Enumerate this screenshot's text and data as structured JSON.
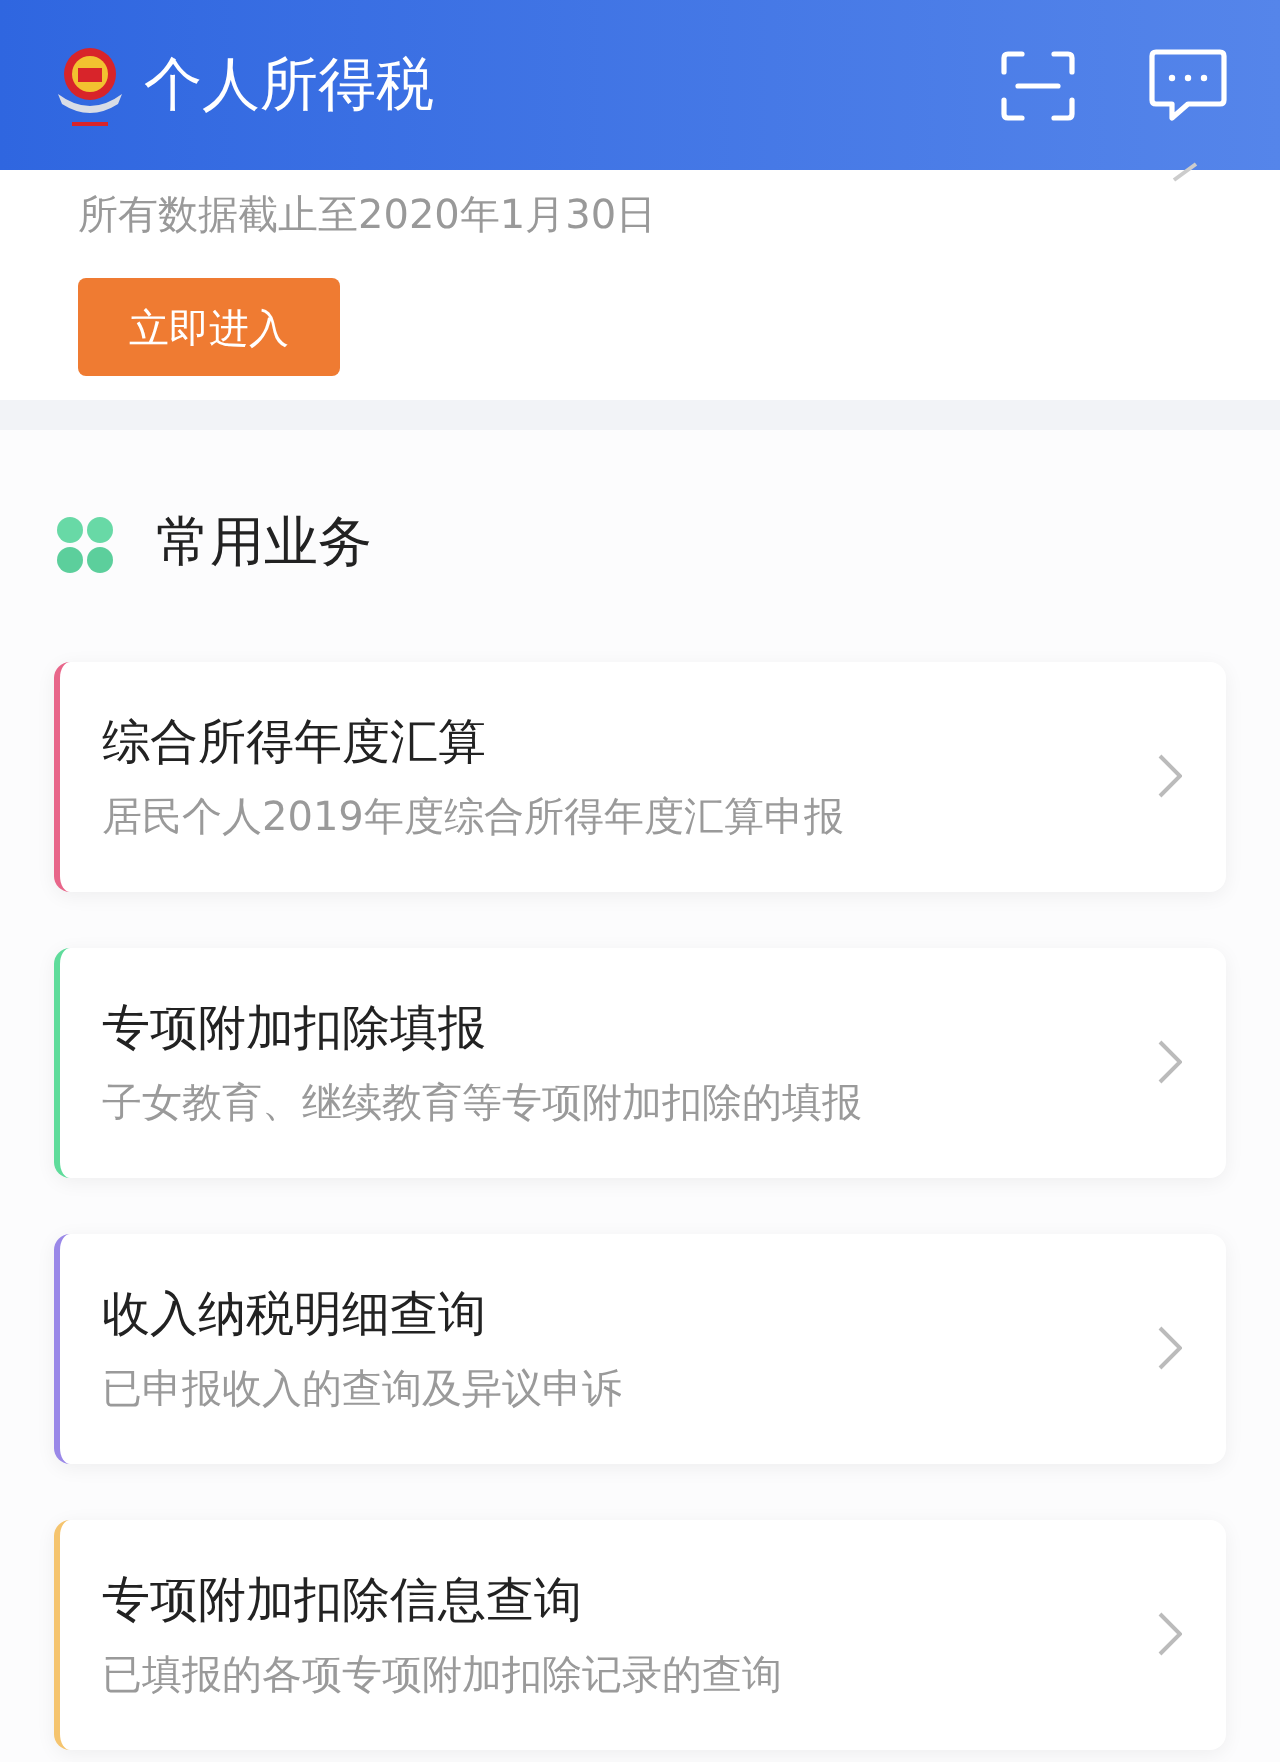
{
  "header": {
    "title": "个人所得税"
  },
  "notice": {
    "text": "所有数据截止至2020年1月30日",
    "button": "立即进入"
  },
  "section": {
    "title": "常用业务"
  },
  "services": [
    {
      "title": "综合所得年度汇算",
      "subtitle": "居民个人2019年度综合所得年度汇算申报",
      "color": "#e8668a"
    },
    {
      "title": "专项附加扣除填报",
      "subtitle": "子女教育、继续教育等专项附加扣除的填报",
      "color": "#5fdc9b"
    },
    {
      "title": "收入纳税明细查询",
      "subtitle": "已申报收入的查询及异议申诉",
      "color": "#9a88e8"
    },
    {
      "title": "专项附加扣除信息查询",
      "subtitle": "已填报的各项专项附加扣除记录的查询",
      "color": "#f5c46e"
    }
  ]
}
